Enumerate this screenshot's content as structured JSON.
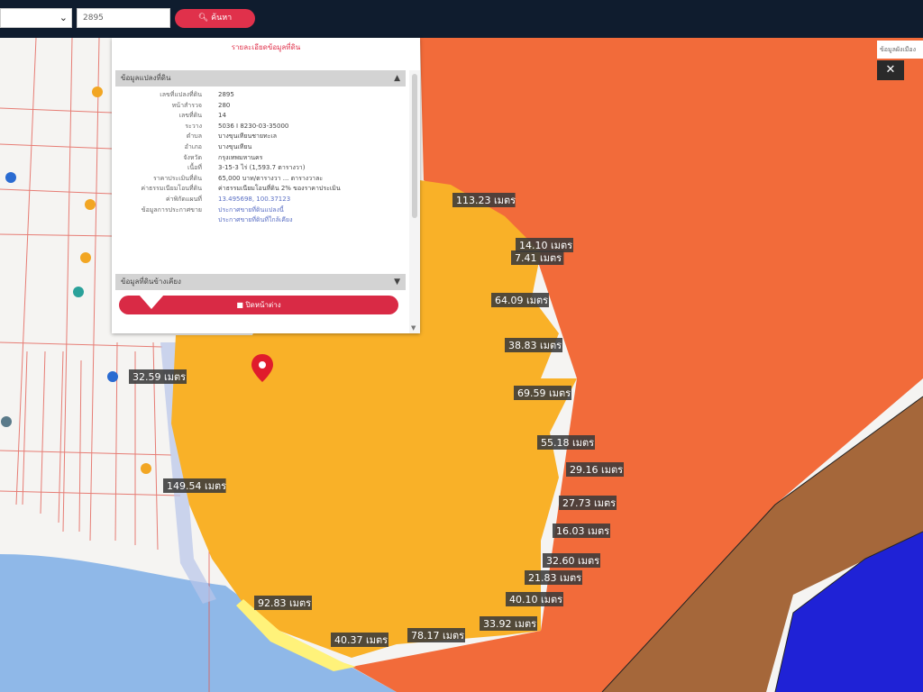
{
  "toolbar": {
    "search_value": "2895",
    "search_button_label": "ค้นหา",
    "selected_option": ""
  },
  "popup": {
    "title": "รายละเอียดข้อมูลที่ดิน",
    "section1_title": "ข้อมูลแปลงที่ดิน",
    "section2_title": "ข้อมูลที่ดินข้างเคียง",
    "rows": [
      {
        "k": "เลขที่แปลงที่ดิน",
        "v": "2895",
        "link": false
      },
      {
        "k": "หน้าสำรวจ",
        "v": "280",
        "link": false
      },
      {
        "k": "เลขที่ดิน",
        "v": "14",
        "link": false
      },
      {
        "k": "ระวาง",
        "v": "5036 I 8230-03-35000",
        "link": false
      },
      {
        "k": "ตำบล",
        "v": "บางขุนเทียนชายทะเล",
        "link": false
      },
      {
        "k": "อำเภอ",
        "v": "บางขุนเทียน",
        "link": false
      },
      {
        "k": "จังหวัด",
        "v": "กรุงเทพมหานคร",
        "link": false
      },
      {
        "k": "เนื้อที่",
        "v": "3-15-3 ไร่ (1,593.7 ตารางวา)",
        "link": false
      },
      {
        "k": "ราคาประเมินที่ดิน",
        "v": "65,000 บาท/ตารางวา ... ตารางวาละ",
        "link": false
      },
      {
        "k": "ค่าธรรมเนียมโอนที่ดิน",
        "v": "ค่าธรรมเนียมโอนที่ดิน 2% ของราคาประเมิน",
        "link": false
      },
      {
        "k": "ค่าพิกัดแผนที่",
        "v": "13.495698, 100.37123",
        "link": true
      },
      {
        "k": "ข้อมูลการประกาศขาย",
        "v": "ประกาศขายที่ดินแปลงนี้",
        "link": true
      },
      {
        "k": "",
        "v": "ประกาศขายที่ดินที่ใกล้เคียง",
        "link": true
      }
    ],
    "action_button_label": "■ ปิดหน้าต่าง"
  },
  "map": {
    "tip_text": "ข้อมูลผังเมือง",
    "close_label": "✕",
    "distance_labels": [
      {
        "text": "113.23 เมตร"
      },
      {
        "text": "14.10 เมตร"
      },
      {
        "text": "7.41 เมตร"
      },
      {
        "text": "64.09 เมตร"
      },
      {
        "text": "38.83 เมตร"
      },
      {
        "text": "69.59 เมตร"
      },
      {
        "text": "55.18 เมตร"
      },
      {
        "text": "29.16 เมตร"
      },
      {
        "text": "27.73 เมตร"
      },
      {
        "text": "16.03 เมตร"
      },
      {
        "text": "32.60 เมตร"
      },
      {
        "text": "21.83 เมตร"
      },
      {
        "text": "40.10 เมตร"
      },
      {
        "text": "33.92 เมตร"
      },
      {
        "text": "78.17 เมตร"
      },
      {
        "text": "40.37 เมตร"
      },
      {
        "text": "92.83 เมตร"
      },
      {
        "text": "32.59 เมตร"
      },
      {
        "text": "149.54 เมตร"
      }
    ],
    "colors": {
      "zone_orange_red": "#f26b3a",
      "zone_yellow": "#f9b128",
      "zone_brown": "#a5673a",
      "zone_blue": "#1f22d6",
      "water": "#8fb8e8",
      "land_white": "#f5f4f2",
      "parcel_lines": "#e2554b",
      "marker_red": "#e01c2c"
    }
  }
}
